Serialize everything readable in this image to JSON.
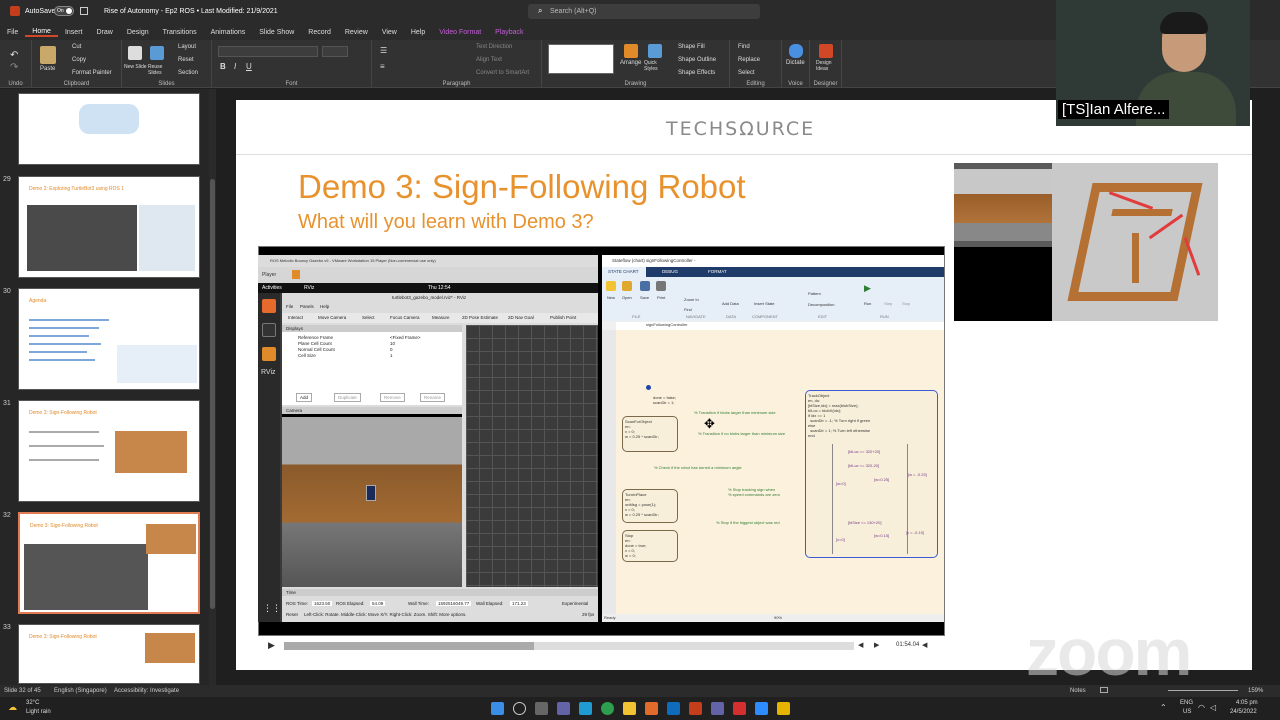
{
  "titlebar": {
    "autosave_label": "AutoSave",
    "autosave_state": "On",
    "doc_title": "Rise of Autonomy - Ep2 ROS  •  Last Modified: 21/9/2021",
    "search_placeholder": "Search (Alt+Q)"
  },
  "menu": [
    "File",
    "Home",
    "Insert",
    "Draw",
    "Design",
    "Transitions",
    "Animations",
    "Slide Show",
    "Record",
    "Review",
    "View",
    "Help",
    "Video Format",
    "Playback"
  ],
  "ribbon": {
    "undo": "Undo",
    "clipboard": {
      "paste": "Paste",
      "cut": "Cut",
      "copy": "Copy",
      "format_painter": "Format Painter",
      "label": "Clipboard"
    },
    "slides": {
      "new_slide": "New Slide",
      "reuse": "Reuse Slides",
      "layout": "Layout",
      "reset": "Reset",
      "section": "Section",
      "label": "Slides"
    },
    "font_label": "Font",
    "paragraph": {
      "text_direction": "Text Direction",
      "align_text": "Align Text",
      "convert": "Convert to SmartArt",
      "label": "Paragraph"
    },
    "drawing": {
      "arrange": "Arrange",
      "quick_styles": "Quick Styles",
      "shape_fill": "Shape Fill",
      "shape_outline": "Shape Outline",
      "shape_effects": "Shape Effects",
      "label": "Drawing"
    },
    "editing": {
      "find": "Find",
      "replace": "Replace",
      "select": "Select",
      "label": "Editing"
    },
    "voice": {
      "dictate": "Dictate",
      "label": "Voice"
    },
    "designer": {
      "design_ideas": "Design Ideas",
      "label": "Designer"
    }
  },
  "thumbnails": [
    {
      "num": "",
      "title": ""
    },
    {
      "num": "29",
      "title": "Demo 2: Exploring TurtleBot3 using ROS 1"
    },
    {
      "num": "30",
      "title": "Agenda"
    },
    {
      "num": "31",
      "title": "Demo 3: Sign-Following Robot"
    },
    {
      "num": "32",
      "title": "Demo 3: Sign-Following Robot"
    },
    {
      "num": "33",
      "title": "Demo 3: Sign-Following Robot"
    }
  ],
  "slide": {
    "logo": "TECHSΩURCE",
    "title": "Demo 3: Sign-Following Robot",
    "subtitle": "What will you learn with Demo 3?"
  },
  "ros_window": {
    "vm_title": "ROS Melodic Bouncy Gazebo v9 - VMware Workstation 15 Player (Non-commercial use only)",
    "player": "Player",
    "activities": "Activities",
    "rviz_menu": "RViz",
    "clock": "Thu 12:54",
    "rviz_title": "turtlebot3_gazebo_model.rviz* - RViz",
    "menu": [
      "File",
      "Panels",
      "Help"
    ],
    "tools": [
      "Interact",
      "Move Camera",
      "Select",
      "Focus Camera",
      "Measure",
      "2D Pose Estimate",
      "2D Nav Goal",
      "Publish Point"
    ],
    "displays_title": "Displays",
    "displays": [
      {
        "k": "Reference Frame",
        "v": "<Fixed Frame>"
      },
      {
        "k": "Plane Cell Count",
        "v": "10"
      },
      {
        "k": "Normal Cell Count",
        "v": "0"
      },
      {
        "k": "Cell Size",
        "v": "1"
      }
    ],
    "buttons": [
      "Add",
      "Duplicate",
      "Remove",
      "Rename"
    ],
    "camera_title": "Camera",
    "time_title": "Time",
    "ros_time_label": "ROS Time:",
    "ros_time": "1623.50",
    "ros_elapsed_label": "ROS Elapsed:",
    "ros_elapsed": "54.09",
    "wall_time_label": "Wall Time:",
    "wall_time": "1592516049.77",
    "wall_elapsed_label": "Wall Elapsed:",
    "wall_elapsed": "171.23",
    "experimental": "Experimental",
    "reset": "Reset",
    "hint": "Left-Click: Rotate. Middle-Click: Move X/Y. Right-Click: Zoom. Shift: More options.",
    "fps": "29 fps"
  },
  "stateflow": {
    "title": "Stateflow (chart) signFollowingController - ",
    "tabs": [
      "STATE CHART",
      "DEBUG",
      "FORMAT"
    ],
    "tools": [
      "New",
      "Open",
      "Save",
      "Print",
      "Zoom In",
      "Find",
      "Add Data",
      "Insert State",
      "Pattern",
      "Decomposition",
      "Run",
      "Step",
      "Stop"
    ],
    "sections": [
      "FILE",
      "NAVIGATE",
      "DATA",
      "COMPONENT",
      "EDIT",
      "RUN"
    ],
    "breadcrumb": "signFollowingController",
    "states": {
      "scan": "ScanForObject\nen:\nv = 0;\nw = 0.25 * scanDir;",
      "turn": "TurnInPlace\nen:\nonMsg = pose(1);\nv = 0;\nw = 0.25 * scanDir;",
      "stop": "Stop\nen:\ndone = true;\nv = 0;\nw = 0;",
      "track": "TrackObject\nen, du:\n[blSize,idx] = max(blobSize);\nblLoc = blobX(idx);\nif idx == 1\n  scanDir = -1; % Turn right if green\nelse\n  scanDir = 1; % Turn left otherwise\nend"
    },
    "init": "done = false;\nscanDir = 1;",
    "notes": [
      "% Transition if blobs larger than minimum size",
      "% Transition if no blobs larger than minimum size",
      "% Check if the robot has turned a minimum angle",
      "% Stop tracking sign when\n% speed commands are zero",
      "% Stop if the biggest object was red"
    ],
    "conds": [
      "[blLoc <= 320-20]",
      "[blLoc >= 320+20]",
      "[w=0.25]",
      "[w = -0.25]",
      "[w=0]",
      "[blSize >= 130-20]",
      "[blSize <= 130+20]",
      "[w=0.15]",
      "[v = -0.15]",
      "[v=0]"
    ],
    "status_ready": "Ready",
    "zoom": "90%"
  },
  "video": {
    "time": "01:54.04"
  },
  "zoom_overlay": {
    "name": "[TS]Ian Alfere...",
    "logo_text": "zoom"
  },
  "statusbar": {
    "slide_of": "Slide 32 of 45",
    "language": "English (Singapore)",
    "accessibility": "Accessibility: Investigate",
    "notes": "Notes",
    "zoom": "159%"
  },
  "taskbar": {
    "temp": "32°C",
    "weather": "Light rain",
    "lang": "ENG",
    "region": "US",
    "time": "4:05 pm",
    "date": "24/5/2022"
  }
}
